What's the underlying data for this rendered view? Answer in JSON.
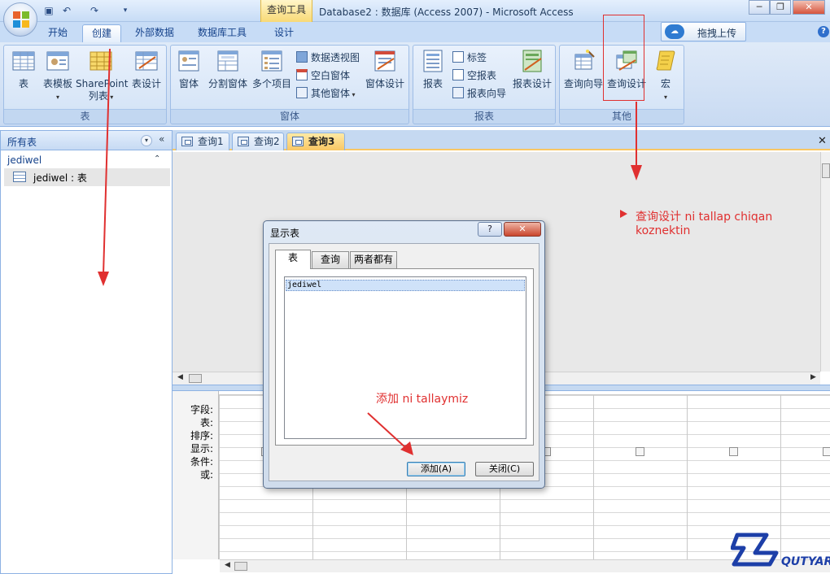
{
  "titlebar": {
    "context_tab": "查询工具",
    "title": "Database2 : 数据库 (Access 2007)  -  Microsoft Access",
    "minimize": "─",
    "restore": "❐",
    "close": "✕"
  },
  "ribbon_tabs": [
    "开始",
    "创建",
    "外部数据",
    "数据库工具",
    "设计"
  ],
  "active_ribbon_tab": "创建",
  "upload_button": "拖拽上传",
  "help_icon": "?",
  "groups": {
    "tables": {
      "label": "表",
      "buttons": {
        "table": "表",
        "table_template": "表模板",
        "sharepoint": "SharePoint",
        "sharepoint_2": "列表",
        "table_design": "表设计"
      }
    },
    "forms": {
      "label": "窗体",
      "buttons": {
        "form": "窗体",
        "split_form": "分割窗体",
        "multiple_items": "多个项目",
        "pivot_chart": "数据透视图",
        "blank_form": "空白窗体",
        "more_forms": "其他窗体",
        "form_design": "窗体设计"
      }
    },
    "reports": {
      "label": "报表",
      "buttons": {
        "report": "报表",
        "labels": "标签",
        "blank_report": "空报表",
        "report_wizard": "报表向导",
        "report_design": "报表设计"
      }
    },
    "other": {
      "label": "其他",
      "buttons": {
        "query_wizard": "查询向导",
        "query_design": "查询设计",
        "macro": "宏"
      }
    }
  },
  "nav_pane": {
    "header": "所有表",
    "shutter": "«",
    "group": "jediwel",
    "item": "jediwel : 表"
  },
  "doc_tabs": [
    "查询1",
    "查询2",
    "查询3"
  ],
  "active_doc_tab": "查询3",
  "qbe_labels": [
    "字段:",
    "表:",
    "排序:",
    "显示:",
    "条件:",
    "或:"
  ],
  "dialog": {
    "title": "显示表",
    "help": "?",
    "close": "✕",
    "tabs": [
      "表",
      "查询",
      "两者都有"
    ],
    "list_items": [
      "jediwel"
    ],
    "add_button": "添加(A)",
    "close_button": "关闭(C)"
  },
  "annotations": {
    "query_design_note_line1": "查询设计  ni tallap chiqan",
    "query_design_note_line2": "koznektin",
    "add_note": "添加  ni tallaymiz"
  },
  "watermark": {
    "text": "QUTYAR"
  },
  "colors": {
    "annotation": "#e03030",
    "ribbon_bg": "#c8daf2",
    "active_doc_tab": "#f9c763"
  }
}
